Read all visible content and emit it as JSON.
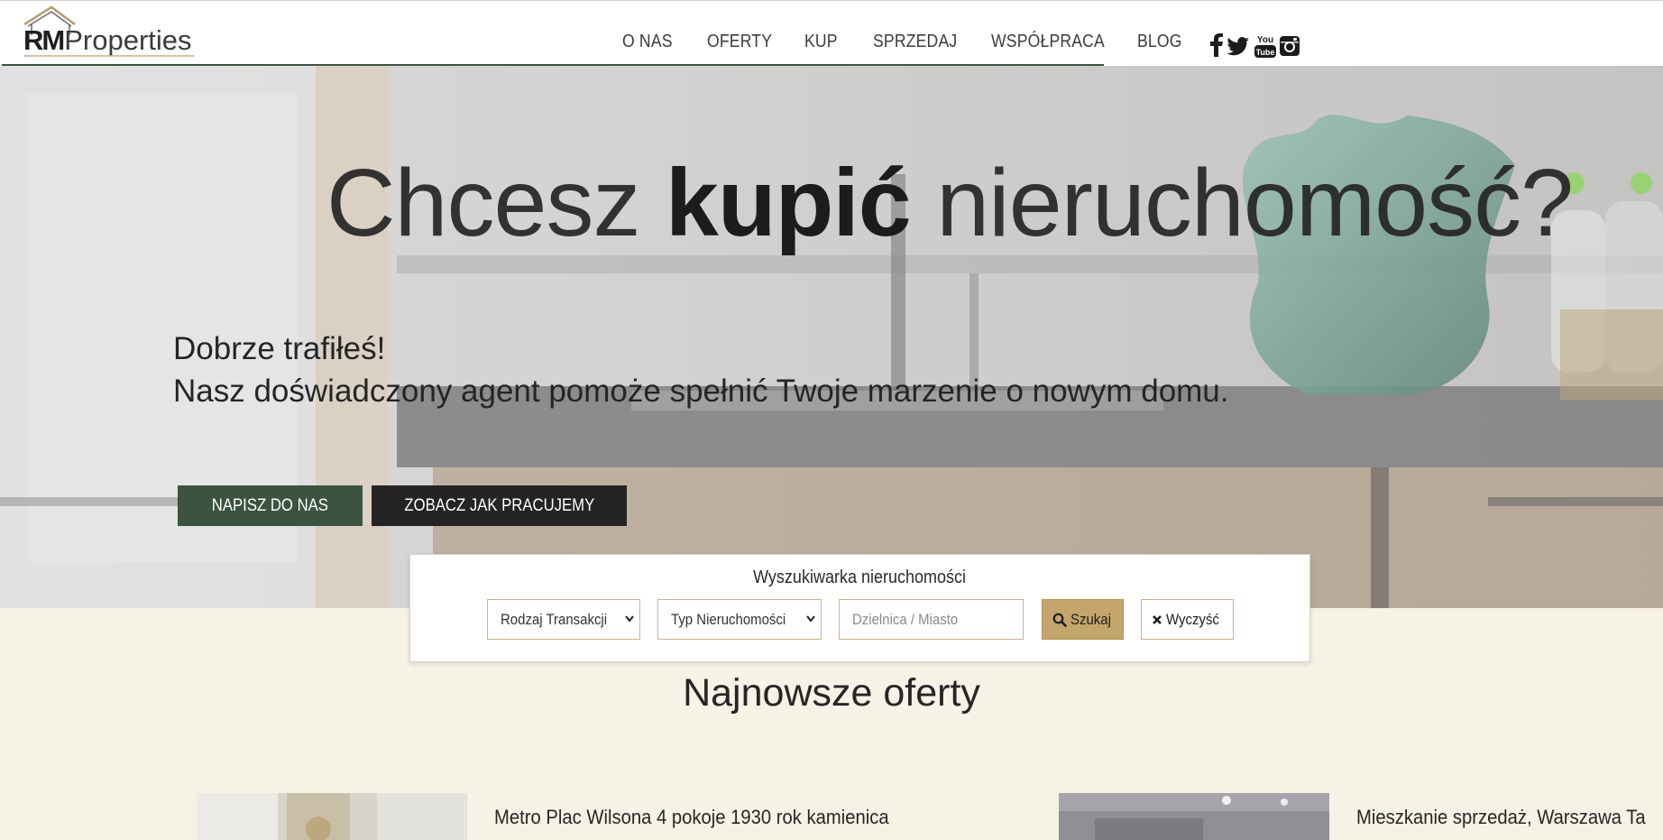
{
  "brand": {
    "logo_rm": "RM",
    "logo_properties": "Properties",
    "color": "#3c5340",
    "accent": "#c4a56c"
  },
  "nav": {
    "items": [
      "O NAS",
      "OFERTY",
      "KUP",
      "SPRZEDAJ",
      "WSPÓŁPRACA",
      "BLOG"
    ],
    "social_icons": [
      "facebook-icon",
      "twitter-icon",
      "youtube-icon",
      "instagram-icon"
    ],
    "youtube_top": "You",
    "youtube_bottom": "Tube"
  },
  "hero": {
    "title_part1": "Chcesz ",
    "title_bold": "kupić",
    "title_part2": " nieruchomość?",
    "subtitle_line1": "Dobrze trafiłeś!",
    "subtitle_line2": "Nasz doświadczony agent pomoże spełnić Twoje marzenie o nowym domu.",
    "button_contact": "NAPISZ DO NAS",
    "button_how": "ZOBACZ JAK PRACUJEMY"
  },
  "search": {
    "title": "Wyszukiwarka nieruchomości",
    "transaction_select": "Rodzaj Transakcji",
    "type_select": "Typ Nieruchomości",
    "city_placeholder": "Dzielnica / Miasto",
    "search_label": "Szukaj",
    "clear_label": "Wyczyść"
  },
  "offers": {
    "section_title": "Najnowsze oferty",
    "items": [
      {
        "title": "Metro Plac Wilsona 4 pokoje 1930 rok kamienica"
      },
      {
        "title": "Mieszkanie sprzedaż, Warszawa Ta"
      }
    ]
  }
}
